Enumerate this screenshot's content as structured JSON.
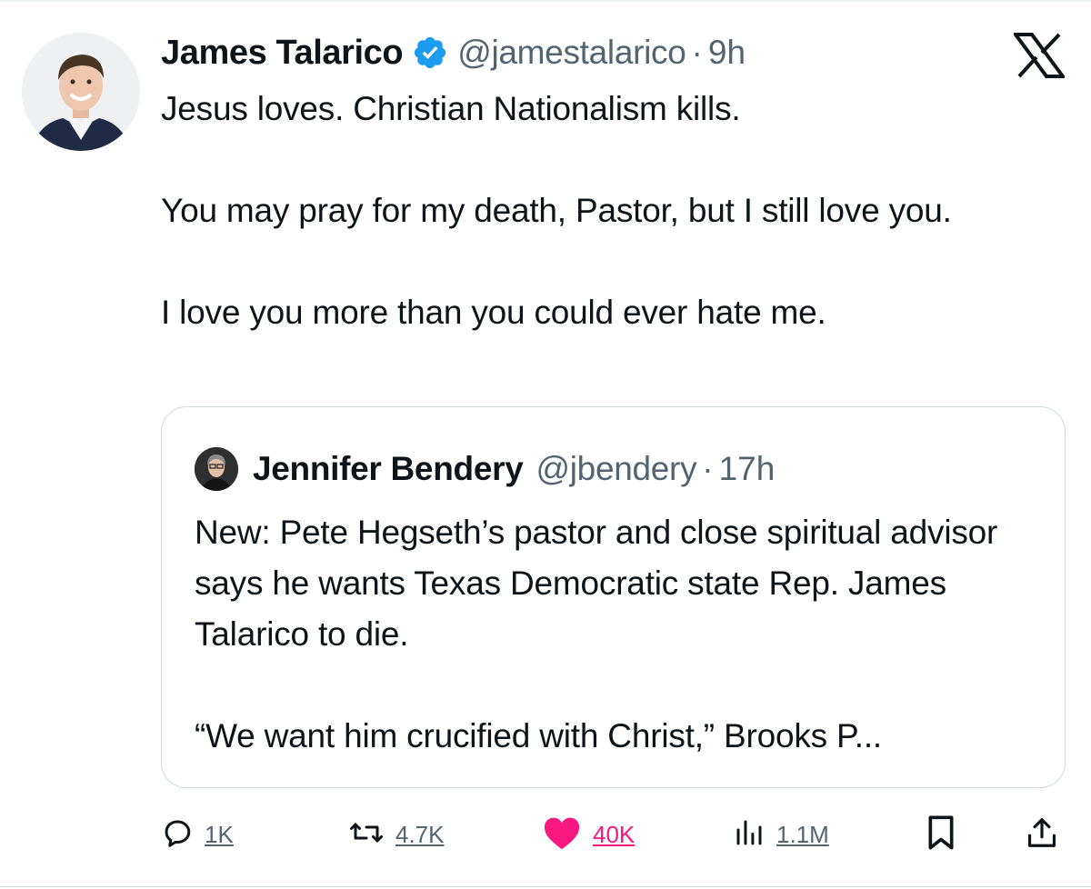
{
  "tweet": {
    "author_name": "James Talarico",
    "verified_icon": "verified-badge-icon",
    "handle": "@jamestalarico",
    "separator": "·",
    "time": "9h",
    "platform_logo": "x-logo-icon",
    "text": {
      "line1": "Jesus loves. Christian Nationalism kills.",
      "line2": "You may pray for my death, Pastor, but I still love you.",
      "line3": "I love you more than you could ever hate me."
    }
  },
  "quote": {
    "author_name": "Jennifer Bendery",
    "handle": "@jbendery",
    "separator": "·",
    "time": "17h",
    "text": {
      "para1": "New: Pete Hegseth’s pastor and close spiritual advisor says he wants Texas Democratic state Rep. James Talarico to die.",
      "para2": "“We want him crucified with Christ,” Brooks P..."
    }
  },
  "actions": {
    "replies": "1K",
    "reposts": "4.7K",
    "likes": "40K",
    "views": "1.1M",
    "icons": [
      "reply-icon",
      "repost-icon",
      "like-icon",
      "views-icon",
      "bookmark-icon",
      "share-icon"
    ]
  },
  "colors": {
    "text_primary": "#0f1419",
    "text_secondary": "#536471",
    "verified_blue": "#1d9bf0",
    "like_pink": "#f91880",
    "border": "#cfd9de"
  }
}
